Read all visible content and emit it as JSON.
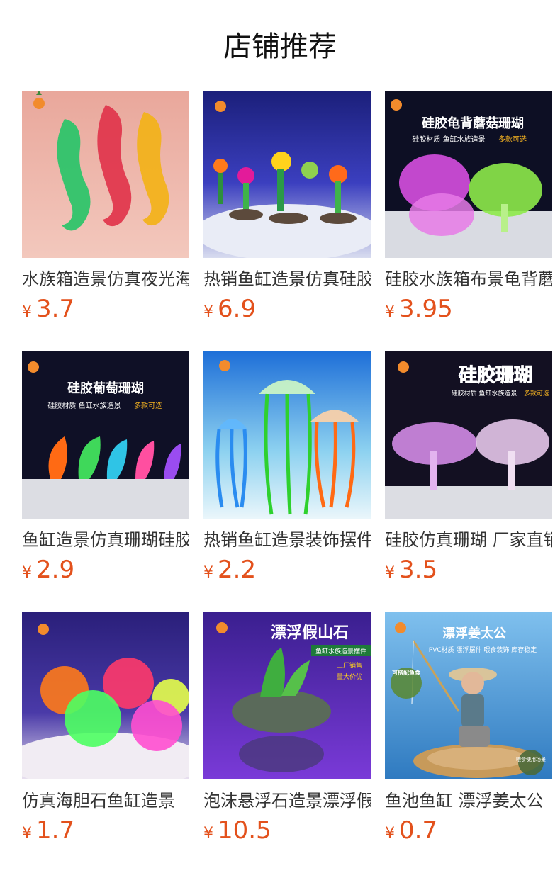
{
  "header": {
    "title": "店铺推荐"
  },
  "products": [
    {
      "name": "水族箱造景仿真夜光海马",
      "currency": "¥",
      "price": "3.7",
      "image": {
        "icon": "seahorse-image",
        "text_lines": []
      }
    },
    {
      "name": "热销鱼缸造景仿真硅胶珊瑚",
      "currency": "¥",
      "price": "6.9",
      "image": {
        "icon": "coral-scene-image",
        "text_lines": []
      }
    },
    {
      "name": "硅胶水族箱布景龟背蘑菇",
      "currency": "¥",
      "price": "3.95",
      "image": {
        "icon": "mushroom-coral-image",
        "text_lines": [
          "硅胶龟背蘑菇珊瑚",
          "硅胶材质 鱼缸水族造景",
          "多款可选"
        ]
      }
    },
    {
      "name": "鱼缸造景仿真珊瑚硅胶葡萄",
      "currency": "¥",
      "price": "2.9",
      "image": {
        "icon": "grape-coral-image",
        "text_lines": [
          "硅胶葡萄珊瑚",
          "硅胶材质 鱼缸水族造景",
          "多款可选"
        ]
      }
    },
    {
      "name": "热销鱼缸造景装饰摆件水母",
      "currency": "¥",
      "price": "2.2",
      "image": {
        "icon": "jellyfish-image",
        "text_lines": []
      }
    },
    {
      "name": "硅胶仿真珊瑚 厂家直销",
      "currency": "¥",
      "price": "3.5",
      "image": {
        "icon": "silicone-coral-image",
        "text_lines": [
          "硅胶珊瑚",
          "硅胶材质 鱼缸水族造景",
          "多款可选"
        ]
      }
    },
    {
      "name": "仿真海胆石鱼缸造景",
      "currency": "¥",
      "price": "1.7",
      "image": {
        "icon": "sea-urchin-image",
        "text_lines": []
      }
    },
    {
      "name": "泡沫悬浮石造景漂浮假山",
      "currency": "¥",
      "price": "10.5",
      "image": {
        "icon": "floating-rock-image",
        "text_lines": [
          "漂浮假山石",
          "鱼缸水族造景摆件",
          "工厂销售",
          "量大价优"
        ]
      }
    },
    {
      "name": "鱼池鱼缸 漂浮姜太公",
      "currency": "¥",
      "price": "0.7",
      "image": {
        "icon": "fisherman-figure-image",
        "text_lines": [
          "漂浮姜太公",
          "PVC材质 漂浮摆件 喂食装饰 库存稳定",
          "可搭配鱼食",
          "喂食使用场景"
        ]
      }
    }
  ]
}
